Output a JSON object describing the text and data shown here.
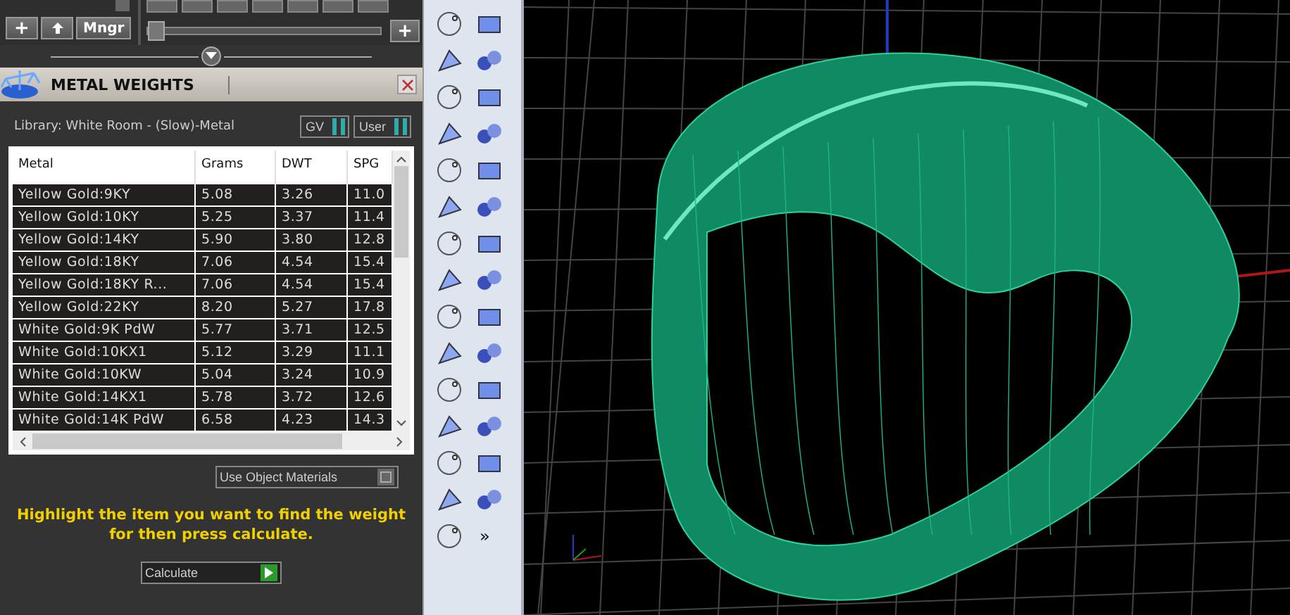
{
  "top_toolbar": {
    "buttons": [
      {
        "kind": "plus",
        "label": "+"
      },
      {
        "kind": "up"
      },
      {
        "kind": "text",
        "label": "Mngr"
      }
    ],
    "slider": {
      "level": 0.0
    },
    "end_button": "+"
  },
  "panel": {
    "title": "METAL WEIGHTS",
    "library": "Library: White Room - (Slow)-Metal",
    "toggles": [
      {
        "label": "GV",
        "on": true
      },
      {
        "label": "User",
        "on": true
      }
    ],
    "table": {
      "columns": [
        "Metal",
        "Grams",
        "DWT",
        "SPG"
      ],
      "rows": [
        [
          "Yellow Gold:9KY",
          "5.08",
          "3.26",
          "11.0"
        ],
        [
          "Yellow Gold:10KY",
          "5.25",
          "3.37",
          "11.4"
        ],
        [
          "Yellow Gold:14KY",
          "5.90",
          "3.80",
          "12.8"
        ],
        [
          "Yellow Gold:18KY",
          "7.06",
          "4.54",
          "15.4"
        ],
        [
          "Yellow Gold:18KY R...",
          "7.06",
          "4.54",
          "15.4"
        ],
        [
          "Yellow Gold:22KY",
          "8.20",
          "5.27",
          "17.8"
        ],
        [
          "White Gold:9K PdW",
          "5.77",
          "3.71",
          "12.5"
        ],
        [
          "White Gold:10KX1",
          "5.12",
          "3.29",
          "11.1"
        ],
        [
          "White Gold:10KW",
          "5.04",
          "3.24",
          "10.9"
        ],
        [
          "White Gold:14KX1",
          "5.78",
          "3.72",
          "12.6"
        ],
        [
          "White Gold:14K PdW",
          "6.58",
          "4.23",
          "14.3"
        ]
      ]
    },
    "use_object_materials": {
      "label": "Use Object Materials",
      "checked": false
    },
    "message": "Highlight the item you want to find the weight for then press calculate.",
    "calculate_button": "Calculate"
  },
  "tool_palette": {
    "more": "»"
  }
}
